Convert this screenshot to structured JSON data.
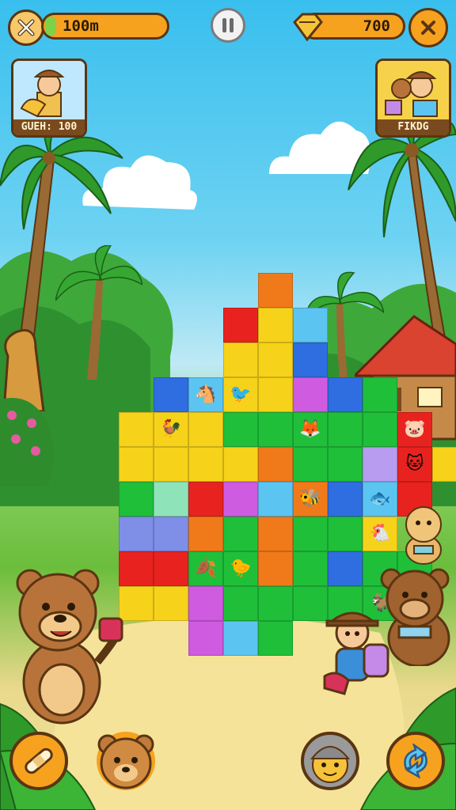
{
  "hud": {
    "distance_text": "100m",
    "coins_text": "700",
    "pause_icon": "pause-icon",
    "close_icon": "x-icon",
    "coin_icon": "gem-icon"
  },
  "cards": {
    "left_label": "GUEH: 100",
    "right_label": "FIKDG"
  },
  "board": {
    "colors": {
      "R": "#e8231f",
      "O": "#f07a1a",
      "Y": "#f7d21a",
      "B": "#2f6ee0",
      "L": "#5cc4f0",
      "G": "#1fbf3a",
      "P": "#cf5be0",
      "V": "#b89cf0",
      "M": "#8fe3b8",
      "I": "#7f8fe8"
    },
    "rows": [
      "......O......",
      ".....RYL.....",
      ".....YYB.....",
      "...BLYYPBG...",
      "..YYYGGGGGR..",
      "..YYYYOGGVRY.",
      "..GMRPLOBLR..",
      "..IIOGOGGY...",
      "..RRGGOGBGG..",
      "..YYPGGGGGG..",
      "....PLG......"
    ],
    "animals": [
      {
        "r": 3,
        "c": 0,
        "e": "🐔"
      },
      {
        "r": 4,
        "c": 0,
        "e": "🐦"
      },
      {
        "r": 5,
        "c": 0,
        "e": "🦊"
      },
      {
        "r": 7,
        "c": 0,
        "e": "🐻"
      },
      {
        "r": 8,
        "c": 0,
        "e": "🐑"
      },
      {
        "r": 3,
        "c": 4,
        "e": "🐴"
      },
      {
        "r": 3,
        "c": 5,
        "e": "🐦"
      },
      {
        "r": 4,
        "c": 3,
        "e": "🐓"
      },
      {
        "r": 4,
        "c": 7,
        "e": "🦊"
      },
      {
        "r": 4,
        "c": 10,
        "e": "🐷"
      },
      {
        "r": 5,
        "c": 1,
        "e": "🐧"
      },
      {
        "r": 5,
        "c": 10,
        "e": "🐱"
      },
      {
        "r": 6,
        "c": 7,
        "e": "🐝"
      },
      {
        "r": 6,
        "c": 9,
        "e": "🐟"
      },
      {
        "r": 7,
        "c": 9,
        "e": "🐔"
      },
      {
        "r": 8,
        "c": 4,
        "e": "🍂"
      },
      {
        "r": 8,
        "c": 5,
        "e": "🐤"
      },
      {
        "r": 9,
        "c": 9,
        "e": "🐐"
      }
    ]
  },
  "buttons": {
    "bottom_left_icon": "bandage-icon",
    "bottom_right_icon": "refresh-icon",
    "bear_avatar_icon": "bear-icon",
    "character_avatar_icon": "character-icon"
  }
}
